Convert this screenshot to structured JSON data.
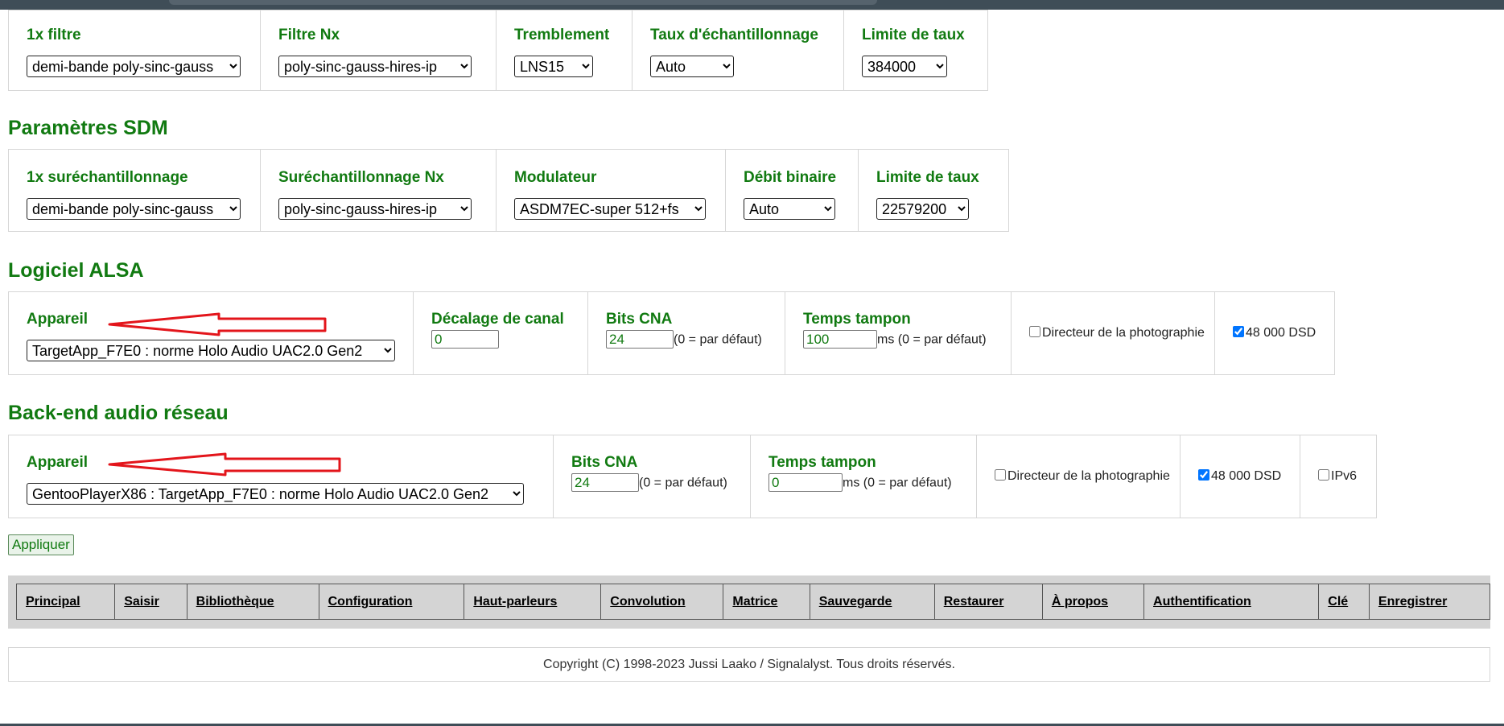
{
  "resampling": {
    "filter1x": {
      "label": "1x filtre",
      "value": "demi-bande poly-sinc-gauss"
    },
    "filterNx": {
      "label": "Filtre Nx",
      "value": "poly-sinc-gauss-hires-ip"
    },
    "dither": {
      "label": "Tremblement",
      "value": "LNS15"
    },
    "samplerate": {
      "label": "Taux d'échantillonnage",
      "value": "Auto"
    },
    "ratelimit": {
      "label": "Limite de taux",
      "value": "384000"
    }
  },
  "sdm": {
    "title": "Paramètres SDM",
    "oversampling1x": {
      "label": "1x suréchantillonnage",
      "value": "demi-bande poly-sinc-gauss"
    },
    "oversamplingNx": {
      "label": "Suréchantillonnage Nx",
      "value": "poly-sinc-gauss-hires-ip"
    },
    "modulator": {
      "label": "Modulateur",
      "value": "ASDM7EC-super 512+fs"
    },
    "bitrate": {
      "label": "Débit binaire",
      "value": "Auto"
    },
    "ratelimit": {
      "label": "Limite de taux",
      "value": "22579200"
    }
  },
  "alsa": {
    "title": "Logiciel ALSA",
    "device": {
      "label": "Appareil",
      "value": "TargetApp_F7E0 : norme Holo Audio UAC2.0 Gen2"
    },
    "channel_offset": {
      "label": "Décalage de canal",
      "value": "0"
    },
    "dac_bits": {
      "label": "Bits CNA",
      "value": "24",
      "hint": "(0 = par défaut)"
    },
    "buffer_time": {
      "label": "Temps tampon",
      "value": "100",
      "hint": "ms (0 = par défaut)"
    },
    "dop": {
      "label": "Directeur de la photographie",
      "checked": false
    },
    "dsd48k": {
      "label": "48 000 DSD",
      "checked": true
    }
  },
  "network": {
    "title": "Back-end audio réseau",
    "device": {
      "label": "Appareil",
      "value": "GentooPlayerX86 : TargetApp_F7E0 : norme Holo Audio UAC2.0 Gen2"
    },
    "dac_bits": {
      "label": "Bits CNA",
      "value": "24",
      "hint": "(0 = par défaut)"
    },
    "buffer_time": {
      "label": "Temps tampon",
      "value": "0",
      "hint": "ms (0 = par défaut)"
    },
    "dop": {
      "label": "Directeur de la photographie",
      "checked": false
    },
    "dsd48k": {
      "label": "48 000 DSD",
      "checked": true
    },
    "ipv6": {
      "label": "IPv6",
      "checked": false
    }
  },
  "apply_label": "Appliquer",
  "nav": [
    "Principal",
    "Saisir",
    "Bibliothèque",
    "Configuration",
    "Haut-parleurs",
    "Convolution",
    "Matrice",
    "Sauvegarde",
    "Restaurer",
    "À propos",
    "Authentification",
    "Clé",
    "Enregistrer"
  ],
  "footer": "Copyright (C) 1998-2023 Jussi Laako / Signalalyst. Tous droits réservés.",
  "colors": {
    "heading_green": "#117a11",
    "arrow_red": "#e3151b",
    "nav_bg": "#d4d4d4"
  }
}
